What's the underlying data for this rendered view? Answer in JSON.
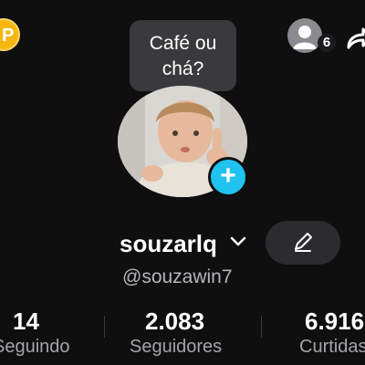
{
  "header": {
    "coin_icon": "coin-icon",
    "viewers_icon": "profile-viewers-icon",
    "viewers_count": "6",
    "share_icon": "share-icon"
  },
  "note_bubble": {
    "text": "Café ou chá?"
  },
  "profile": {
    "avatar_icon": "profile-photo",
    "add_icon": "plus-icon",
    "username": "souzarlq",
    "handle": "@souzawin7",
    "edit_icon": "pencil-icon",
    "accent_color": "#20c3f0"
  },
  "stats": [
    {
      "value": "14",
      "label": "Seguindo"
    },
    {
      "value": "2.083",
      "label": "Seguidores"
    },
    {
      "value": "6.916",
      "label": "Curtidas"
    }
  ]
}
